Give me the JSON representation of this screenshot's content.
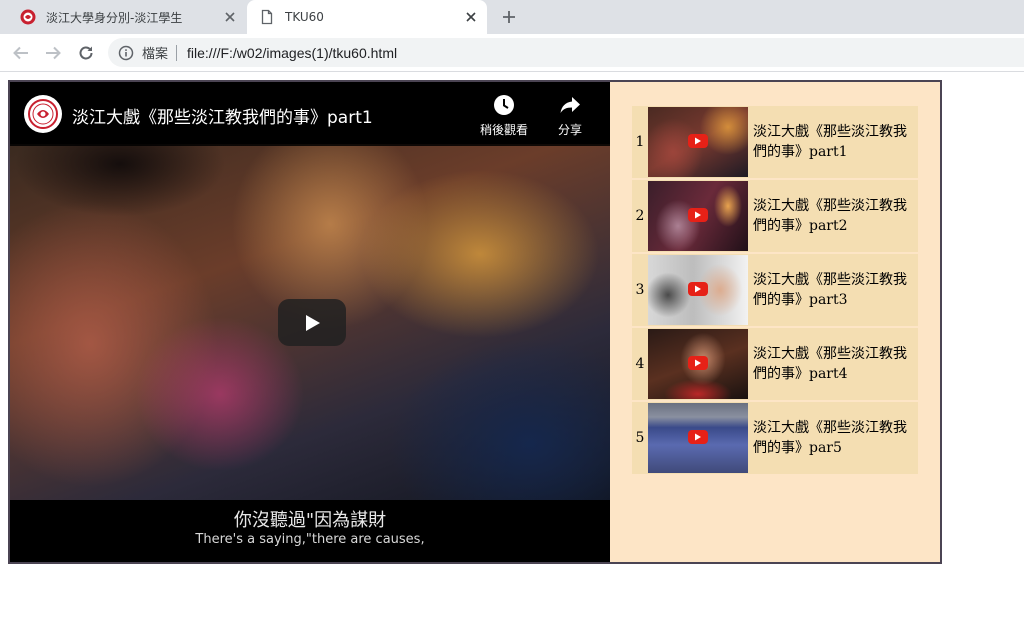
{
  "browser": {
    "tabs": [
      {
        "title": "淡江大學身分別-淡江學生",
        "active": false,
        "favicon": "tku-logo-icon"
      },
      {
        "title": "TKU60",
        "active": true,
        "favicon": "file-icon"
      }
    ],
    "address": {
      "scheme_label": "檔案",
      "url": "file:///F:/w02/images(1)/tku60.html"
    }
  },
  "player": {
    "title": "淡江大戲《那些淡江教我們的事》part1",
    "watch_later_label": "稍後觀看",
    "share_label": "分享",
    "subtitle_zh": "你沒聽過\"因為謀財",
    "subtitle_en": "There's a saying,\"there are causes,"
  },
  "playlist": [
    {
      "number": "1",
      "title": "淡江大戲《那些淡江教我們的事》part1"
    },
    {
      "number": "2",
      "title": "淡江大戲《那些淡江教我們的事》part2"
    },
    {
      "number": "3",
      "title": "淡江大戲《那些淡江教我們的事》part3"
    },
    {
      "number": "4",
      "title": "淡江大戲《那些淡江教我們的事》part4"
    },
    {
      "number": "5",
      "title": "淡江大戲《那些淡江教我們的事》par5"
    }
  ],
  "colors": {
    "page_background": "#fde5c6",
    "playlist_row": "#f4deb2",
    "frame_border": "#4b4453",
    "youtube_red": "#e62117"
  }
}
